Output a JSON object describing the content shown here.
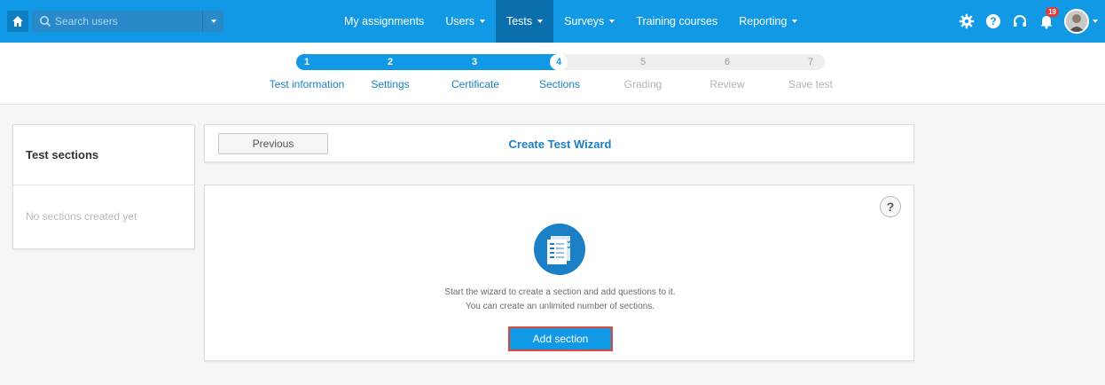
{
  "nav": {
    "search_placeholder": "Search users",
    "menu": [
      {
        "label": "My assignments",
        "has_caret": false
      },
      {
        "label": "Users",
        "has_caret": true
      },
      {
        "label": "Tests",
        "has_caret": true,
        "active": true
      },
      {
        "label": "Surveys",
        "has_caret": true
      },
      {
        "label": "Training courses",
        "has_caret": false
      },
      {
        "label": "Reporting",
        "has_caret": true
      }
    ],
    "notification_count": "19",
    "icons": [
      "home-icon",
      "search-icon",
      "gear-icon",
      "help-icon",
      "headset-icon",
      "bell-icon",
      "avatar"
    ]
  },
  "steps": [
    {
      "num": "1",
      "label": "Test information",
      "state": "done"
    },
    {
      "num": "2",
      "label": "Settings",
      "state": "done"
    },
    {
      "num": "3",
      "label": "Certificate",
      "state": "done"
    },
    {
      "num": "4",
      "label": "Sections",
      "state": "current"
    },
    {
      "num": "5",
      "label": "Grading",
      "state": "todo"
    },
    {
      "num": "6",
      "label": "Review",
      "state": "todo"
    },
    {
      "num": "7",
      "label": "Save test",
      "state": "todo"
    }
  ],
  "left_panel": {
    "title": "Test sections",
    "empty_text": "No sections created yet"
  },
  "wizard": {
    "previous_label": "Previous",
    "title": "Create Test Wizard"
  },
  "main": {
    "help_label": "?",
    "desc_line1": "Start the wizard to create a section and add questions to it.",
    "desc_line2": "You can create an unlimited number of sections.",
    "add_button": "Add section"
  },
  "colors": {
    "primary": "#1199e6",
    "highlight_border": "#e0463c",
    "badge": "#e53935"
  }
}
